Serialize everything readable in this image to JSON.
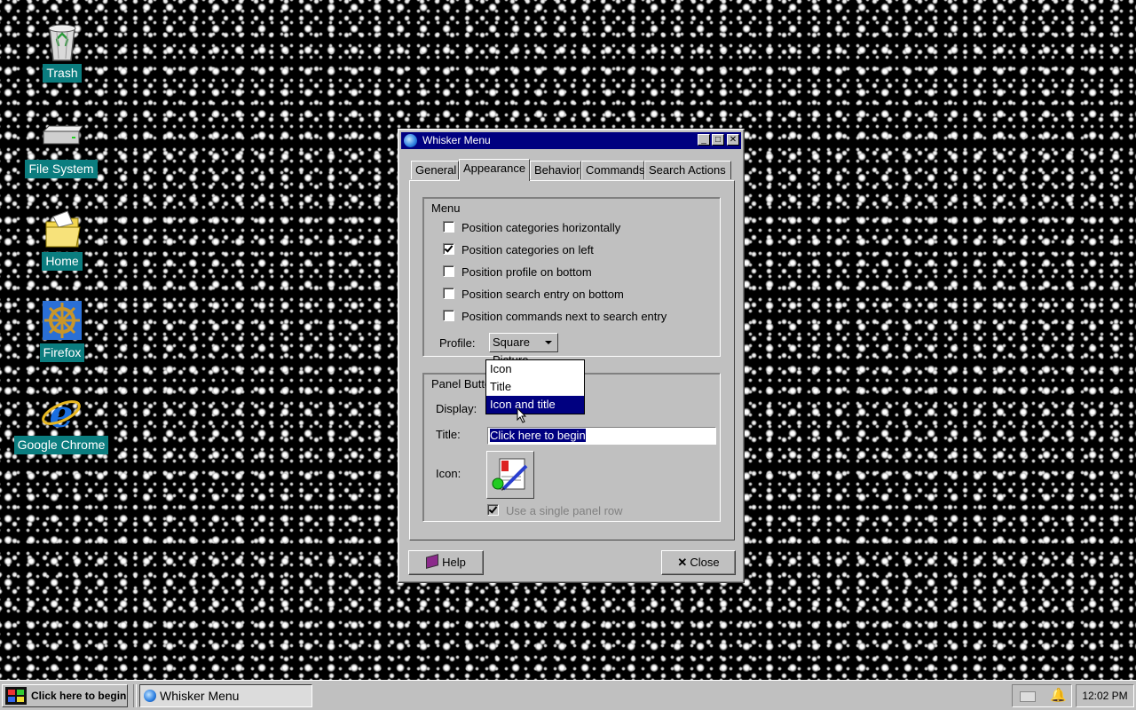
{
  "desktop": {
    "icons": [
      {
        "label": "Trash",
        "icon": "trash-icon"
      },
      {
        "label": "File System",
        "icon": "drive-icon"
      },
      {
        "label": "Home",
        "icon": "folder-icon"
      },
      {
        "label": "Firefox",
        "icon": "ship-wheel-icon"
      },
      {
        "label": "Google Chrome",
        "icon": "ie-icon"
      }
    ]
  },
  "window": {
    "title": "Whisker Menu",
    "controls": {
      "minimize": "_",
      "maximize": "□",
      "close": "✕"
    },
    "tabs": [
      "General",
      "Appearance",
      "Behavior",
      "Commands",
      "Search Actions"
    ],
    "active_tab": "Appearance",
    "menu_group": {
      "title": "Menu",
      "checkboxes": [
        {
          "label": "Position categories horizontally",
          "checked": false
        },
        {
          "label": "Position categories on left",
          "checked": true
        },
        {
          "label": "Position profile on bottom",
          "checked": false
        },
        {
          "label": "Position search entry on bottom",
          "checked": false
        },
        {
          "label": "Position commands next to search entry",
          "checked": false
        }
      ],
      "profile_label": "Profile:",
      "profile_value": "Square Picture"
    },
    "panel_group": {
      "title": "Panel Button",
      "display_label": "Display:",
      "display_options": [
        "Icon",
        "Title",
        "Icon and title"
      ],
      "display_highlighted": "Icon and title",
      "title_label": "Title:",
      "title_value": "Click here to begin",
      "icon_label": "Icon:",
      "single_row_label": "Use a single panel row",
      "single_row_checked": true
    },
    "buttons": {
      "help": "Help",
      "close": "Close"
    }
  },
  "taskbar": {
    "start_label": "Click here to begin",
    "task_label": "Whisker Menu",
    "clock": "12:02 PM"
  },
  "colors": {
    "titlebar": "#000080",
    "desktop_label_bg": "#0b7d7f",
    "window_bg": "#c0c0c0"
  }
}
